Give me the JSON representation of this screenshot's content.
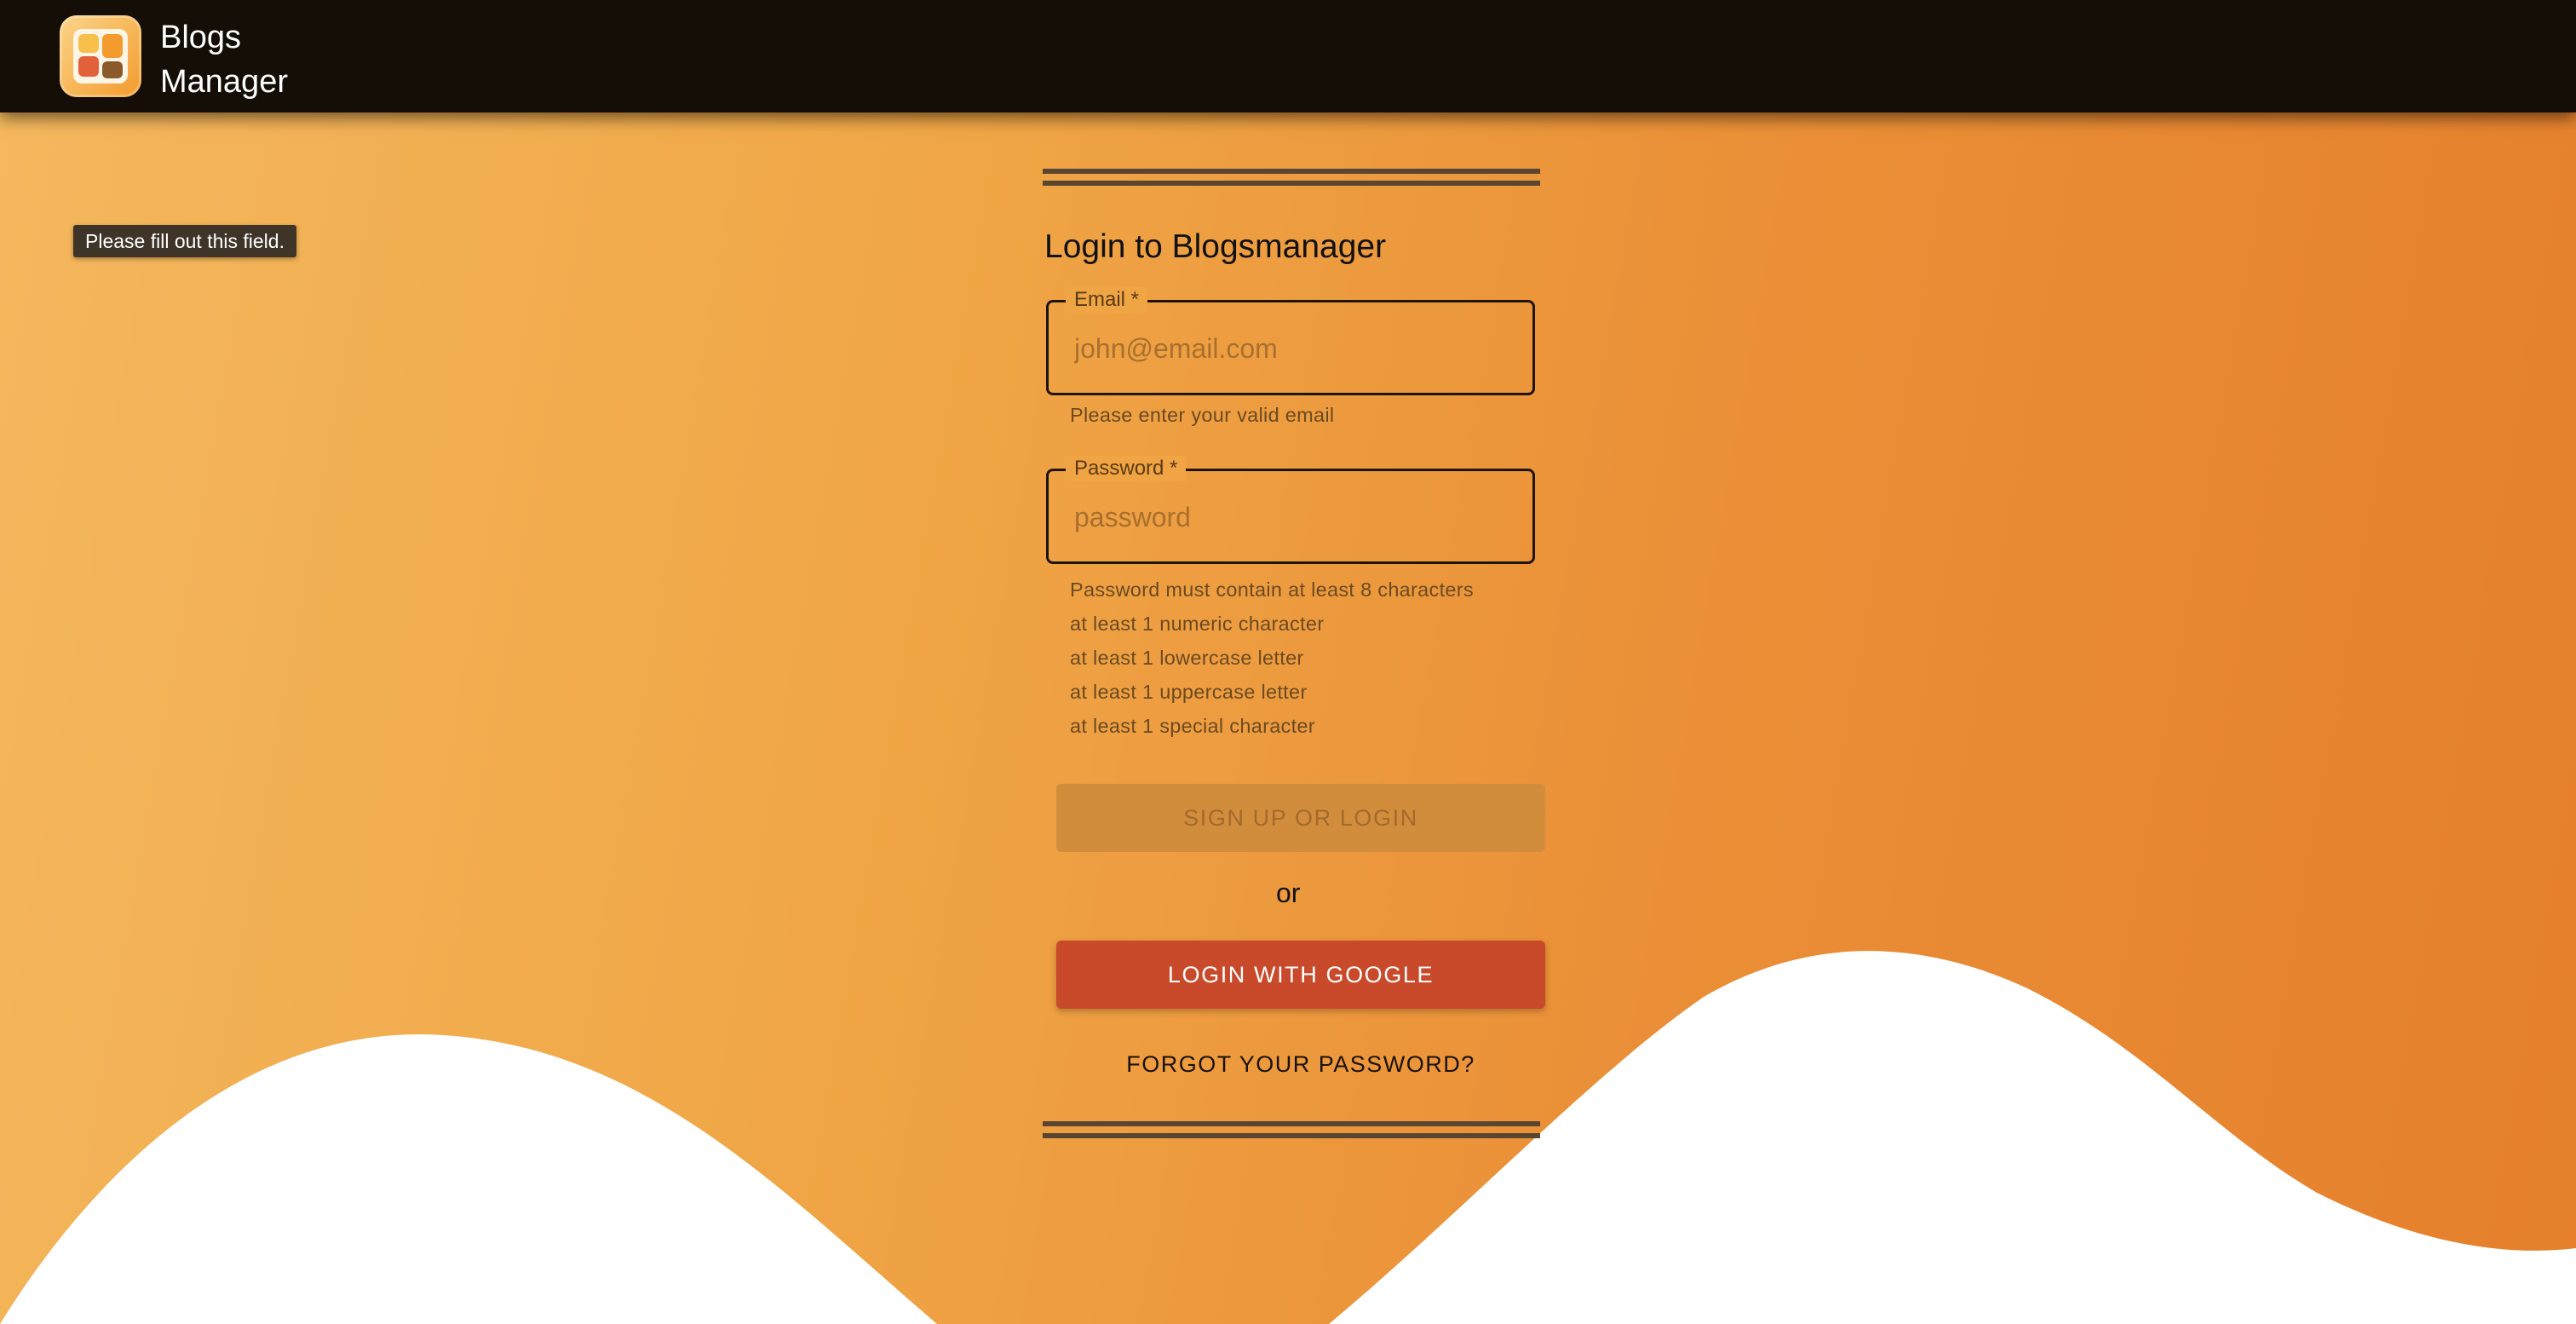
{
  "app": {
    "brand_line1": "Blogs",
    "brand_line2": "Manager",
    "logo_icon": "blog-grid-icon"
  },
  "tooltip": "Please fill out this field.",
  "form": {
    "title": "Login to Blogsmanager",
    "email": {
      "label": "Email *",
      "placeholder": "john@email.com",
      "value": "",
      "helper": "Please enter your valid email"
    },
    "password": {
      "label": "Password *",
      "placeholder": "password",
      "value": "",
      "requirements": [
        "Password must contain at least 8 characters",
        "at least 1 numeric character",
        "at least 1 lowercase letter",
        "at least 1 uppercase letter",
        "at least 1 special character"
      ]
    },
    "signup_button": "SIGN UP OR LOGIN",
    "signup_disabled": true,
    "or_text": "or",
    "google_button": "LOGIN WITH GOOGLE",
    "forgot_link": "FORGOT YOUR PASSWORD?"
  },
  "colors": {
    "topbar": "#140e06",
    "accent": "#c84a2a",
    "background_start": "#f4b85e",
    "background_end": "#e57f2c"
  }
}
